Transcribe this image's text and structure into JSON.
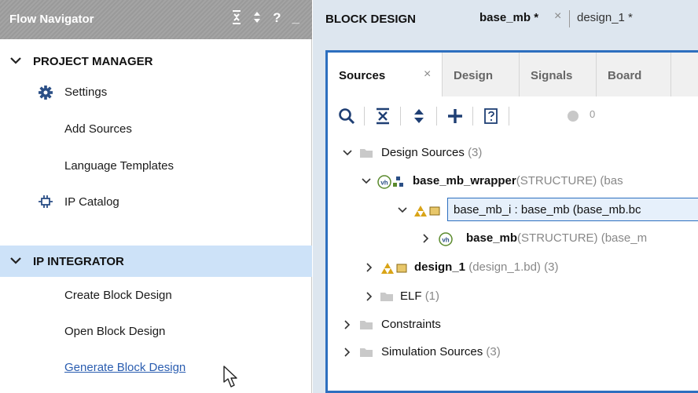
{
  "flow_navigator": {
    "title": "Flow Navigator",
    "tools": {
      "collapse_all": "collapse-all-icon",
      "expand_all": "expand-all-icon",
      "help": "?",
      "minimize": "_"
    },
    "project_manager": {
      "label": "PROJECT MANAGER",
      "items": [
        {
          "label": "Settings",
          "icon": "gear-icon"
        },
        {
          "label": "Add Sources",
          "icon": ""
        },
        {
          "label": "Language Templates",
          "icon": ""
        },
        {
          "label": "IP Catalog",
          "icon": "ip-catalog-icon"
        }
      ]
    },
    "ip_integrator": {
      "label": "IP INTEGRATOR",
      "items": [
        {
          "label": "Create Block Design"
        },
        {
          "label": "Open Block Design"
        },
        {
          "label": "Generate Block Design"
        }
      ]
    }
  },
  "block_design": {
    "title": "BLOCK DESIGN",
    "tabs": [
      {
        "label": "base_mb *",
        "active": true
      },
      {
        "label": "design_1 *",
        "active": false
      }
    ],
    "close_glyph": "×"
  },
  "sources_panel": {
    "tabs": [
      {
        "label": "Sources",
        "active": true
      },
      {
        "label": "Design"
      },
      {
        "label": "Signals"
      },
      {
        "label": "Board"
      }
    ],
    "close_glyph": "×",
    "toolbar": {
      "search": "search-icon",
      "collapse": "collapse-all-icon",
      "expand": "expand-all-icon",
      "add": "plus-icon",
      "properties": "properties-icon",
      "status_count": "0"
    },
    "tree": {
      "design_sources": {
        "label": "Design Sources",
        "count": "(3)"
      },
      "wrapper": {
        "name": "base_mb_wrapper",
        "detail": "(STRUCTURE) (bas"
      },
      "base_mb_i": {
        "name": "base_mb_i : base_mb (base_mb.bc"
      },
      "base_mb": {
        "name": "base_mb",
        "detail": "(STRUCTURE) (base_m"
      },
      "design_1": {
        "name": "design_1",
        "detail": "(design_1.bd)",
        "count": "(3)"
      },
      "elf": {
        "name": "ELF",
        "count": "(1)"
      },
      "constraints": {
        "label": "Constraints"
      },
      "simulation": {
        "label": "Simulation Sources",
        "count": "(3)"
      }
    }
  },
  "colors": {
    "nav_header": "#9a9a9a",
    "selection": "#cde2f8",
    "panel_border": "#2d6fbf",
    "right_bg": "#dde6ef",
    "link": "#2a5db0"
  }
}
